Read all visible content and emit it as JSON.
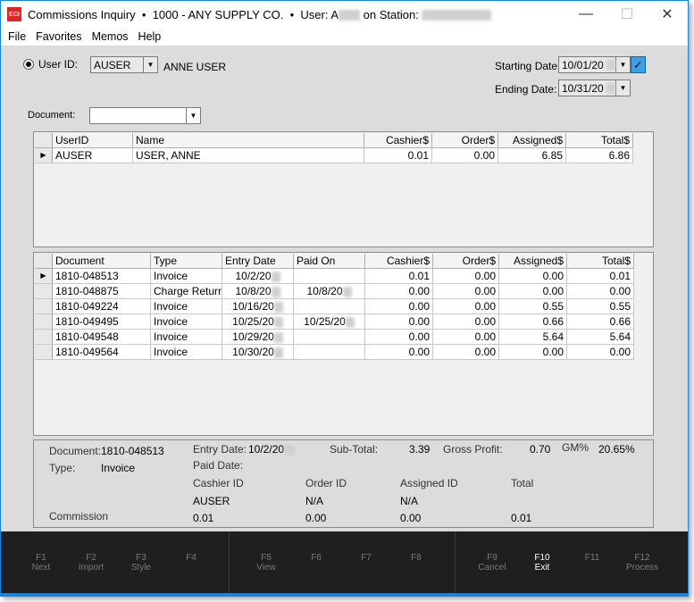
{
  "window": {
    "title": "Commissions Inquiry",
    "company": "1000 - ANY SUPPLY CO.",
    "user_label": "User: A",
    "station_label": "on Station:",
    "logo": "ECI",
    "separator": "•"
  },
  "menu": [
    "File",
    "Favorites",
    "Memos",
    "Help"
  ],
  "filters": {
    "user_id_label": "User ID:",
    "user_id": "AUSER",
    "user_name": "ANNE USER",
    "starting_date_label": "Starting Date:",
    "starting_date": "10/01/20",
    "ending_date_label": "Ending Date:",
    "ending_date": "10/31/20",
    "document_label": "Document:",
    "document": ""
  },
  "summary_grid": {
    "columns": [
      "UserID",
      "Name",
      "Cashier$",
      "Order$",
      "Assigned$",
      "Total$"
    ],
    "rows": [
      [
        "AUSER",
        "USER, ANNE",
        "0.01",
        "0.00",
        "6.85",
        "6.86"
      ]
    ]
  },
  "doc_grid": {
    "columns": [
      "Document",
      "Type",
      "Entry Date",
      "Paid On",
      "Cashier$",
      "Order$",
      "Assigned$",
      "Total$"
    ],
    "rows": [
      [
        "1810-048513",
        "Invoice",
        "10/2/20",
        "",
        "0.01",
        "0.00",
        "0.00",
        "0.01"
      ],
      [
        "1810-048875",
        "Charge Return",
        "10/8/20",
        "10/8/20",
        "0.00",
        "0.00",
        "0.00",
        "0.00"
      ],
      [
        "1810-049224",
        "Invoice",
        "10/16/20",
        "",
        "0.00",
        "0.00",
        "0.55",
        "0.55"
      ],
      [
        "1810-049495",
        "Invoice",
        "10/25/20",
        "10/25/20",
        "0.00",
        "0.00",
        "0.66",
        "0.66"
      ],
      [
        "1810-049548",
        "Invoice",
        "10/29/20",
        "",
        "0.00",
        "0.00",
        "5.64",
        "5.64"
      ],
      [
        "1810-049564",
        "Invoice",
        "10/30/20",
        "",
        "0.00",
        "0.00",
        "0.00",
        "0.00"
      ]
    ]
  },
  "detail": {
    "document_label": "Document:",
    "document": "1810-048513",
    "type_label": "Type:",
    "type": "Invoice",
    "entry_date_label": "Entry Date:",
    "entry_date": "10/2/20",
    "paid_date_label": "Paid Date:",
    "subtotal_label": "Sub-Total:",
    "subtotal": "3.39",
    "gross_profit_label": "Gross Profit:",
    "gross_profit": "0.70",
    "gm_label": "GM%",
    "gm": "20.65%",
    "headers": [
      "Cashier ID",
      "Order ID",
      "Assigned ID",
      "Total"
    ],
    "ids": [
      "AUSER",
      "N/A",
      "N/A"
    ],
    "commission_label": "Commission",
    "commission": [
      "0.01",
      "0.00",
      "0.00",
      "0.01"
    ]
  },
  "function_keys": [
    {
      "key": "F1",
      "label": "Next"
    },
    {
      "key": "F2",
      "label": "Import"
    },
    {
      "key": "F3",
      "label": "Style"
    },
    {
      "key": "F4",
      "label": ""
    },
    {
      "key": "F5",
      "label": "View"
    },
    {
      "key": "F6",
      "label": ""
    },
    {
      "key": "F7",
      "label": ""
    },
    {
      "key": "F8",
      "label": ""
    },
    {
      "key": "F9",
      "label": "Cancel"
    },
    {
      "key": "F10",
      "label": "Exit",
      "active": true
    },
    {
      "key": "F11",
      "label": ""
    },
    {
      "key": "F12",
      "label": "Process"
    }
  ],
  "colors": {
    "accent": "#1883d7",
    "logo": "#e02424",
    "checkbox": "#3aa0e8",
    "fbar": "#1f1f1f"
  }
}
